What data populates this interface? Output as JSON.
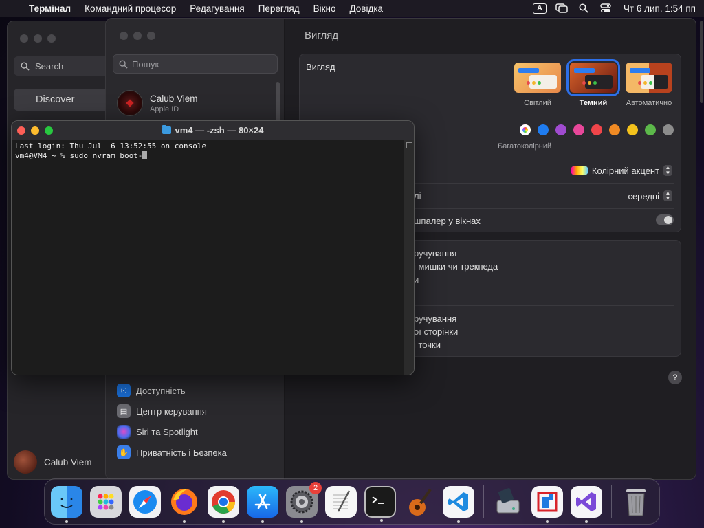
{
  "menubar": {
    "app": "Термінал",
    "items": [
      "Командний процесор",
      "Редагування",
      "Перегляд",
      "Вікно",
      "Довідка"
    ],
    "input_indicator": "A",
    "clock": "Чт 6 лип.  1:54 пп"
  },
  "back_window": {
    "search_placeholder": "Search",
    "discover_label": "Discover",
    "user_name": "Calub Viem"
  },
  "settings": {
    "search_placeholder": "Пошук",
    "account": {
      "name": "Calub Viem",
      "subtitle": "Apple ID"
    },
    "sidebar_items": [
      "Доступність",
      "Центр керування",
      "Siri та Spotlight",
      "Приватність і Безпека"
    ],
    "section_title": "Вигляд",
    "appearance_label": "Вигляд",
    "themes": [
      "Світлий",
      "Темний",
      "Автоматично"
    ],
    "selected_theme": "Темний",
    "accent_colors": [
      "#8e5cff",
      "#1f7cf0",
      "#a04bd0",
      "#e8479a",
      "#f0454a",
      "#f08a24",
      "#f4c21c",
      "#5cb84a",
      "#8c8c8c"
    ],
    "multicolor_label": "Багатоколірний",
    "highlight_popup": "Колірний акцент",
    "sidebar_size_label": "лі",
    "sidebar_size_value": "середні",
    "wallpaper_tint_label": "шпалер у вікнах",
    "scroll_section": [
      "ручування",
      "і мишки чи трекпеда",
      "и"
    ],
    "click_section": [
      "ручування",
      "ої сторінки",
      "і точки"
    ],
    "help": "?"
  },
  "terminal": {
    "title": "vm4 — -zsh — 80×24",
    "lines": [
      "Last login: Thu Jul  6 13:52:55 on console",
      "vm4@VM4 ~ % sudo nvram boot-"
    ]
  },
  "dock": {
    "badge_settings": "2",
    "apps": [
      "finder",
      "launchpad",
      "safari",
      "firefox",
      "chrome",
      "app-store",
      "system-settings",
      "textedit",
      "terminal",
      "garageband",
      "vscode",
      "disk-utility",
      "parallels",
      "visual-studio",
      "trash"
    ]
  },
  "colors": {
    "accent": "#2d6fe8",
    "traffic_red": "#fe5f57",
    "traffic_yellow": "#febc2e",
    "traffic_green": "#28c840"
  }
}
